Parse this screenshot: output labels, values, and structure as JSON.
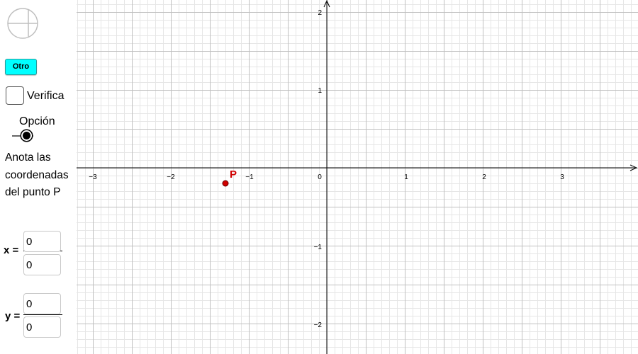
{
  "toolbar": {
    "reset_icon": "reset-circle-icon",
    "otro_label": "Otro"
  },
  "verify": {
    "label": "Verifica",
    "checked": false
  },
  "option": {
    "label": "Opción",
    "value": 1
  },
  "instruction": {
    "line1": "Anota las",
    "line2": "coordenadas",
    "line3": "del punto P"
  },
  "answer": {
    "x_label": "x =",
    "y_label": "y =",
    "x_numerator": "0",
    "x_denominator": "0",
    "y_numerator": "0",
    "y_denominator": "0"
  },
  "graph": {
    "x_ticks": [
      "−3",
      "−2",
      "−1",
      "0",
      "1",
      "2",
      "3"
    ],
    "y_ticks": [
      "2",
      "1",
      "−1",
      "−2"
    ],
    "point": {
      "label": "P",
      "x": -1.3,
      "y": -0.2,
      "color": "#d00000"
    },
    "axis_color": "#000000",
    "grid_major_color": "#c0c0c0",
    "grid_minor_color": "#e6e6e6"
  }
}
